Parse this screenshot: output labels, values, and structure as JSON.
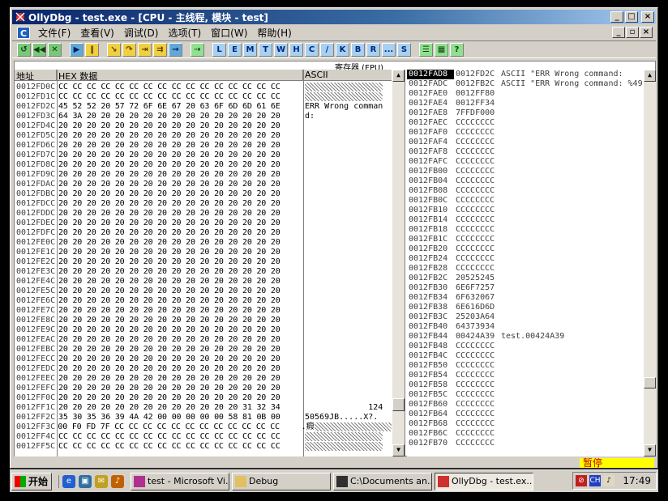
{
  "window": {
    "title": "OllyDbg - test.exe - [CPU - 主线程, 模块 - test]",
    "buttons": {
      "minimize": "_",
      "maximize": "□",
      "close": "×"
    }
  },
  "menu": {
    "items": [
      "文件(F)",
      "查看(V)",
      "调试(D)",
      "选项(T)",
      "窗口(W)",
      "帮助(H)"
    ],
    "mdi": {
      "minimize": "_",
      "restore": "▫",
      "close": "×"
    }
  },
  "toolbar": {
    "buttons": [
      {
        "label": "↺",
        "style": "green",
        "icon": "open-icon"
      },
      {
        "label": "◀◀",
        "style": "green",
        "icon": "restart-icon"
      },
      {
        "label": "✕",
        "style": "green",
        "icon": "close-program-icon"
      },
      {
        "label": "▶",
        "style": "blue",
        "icon": "run-icon"
      },
      {
        "label": "‖",
        "style": "yellow",
        "icon": "pause-icon"
      },
      {
        "label": "↘",
        "style": "yellow",
        "icon": "step-into-icon"
      },
      {
        "label": "↷",
        "style": "yellow",
        "icon": "step-over-icon"
      },
      {
        "label": "⇥",
        "style": "yellow",
        "icon": "trace-into-icon"
      },
      {
        "label": "⇉",
        "style": "yellow",
        "icon": "trace-over-icon"
      },
      {
        "label": "→",
        "style": "blue",
        "icon": "execute-till-return-icon"
      },
      {
        "label": "⇢",
        "style": "lgreen",
        "icon": "goto-icon"
      },
      {
        "label": "L",
        "style": "letter",
        "icon": "log-icon"
      },
      {
        "label": "E",
        "style": "letter",
        "icon": "modules-icon"
      },
      {
        "label": "M",
        "style": "letter",
        "icon": "memory-icon"
      },
      {
        "label": "T",
        "style": "letter",
        "icon": "threads-icon"
      },
      {
        "label": "W",
        "style": "letter",
        "icon": "windows-icon"
      },
      {
        "label": "H",
        "style": "letter",
        "icon": "handles-icon"
      },
      {
        "label": "C",
        "style": "letter",
        "icon": "cpu-icon"
      },
      {
        "label": "/",
        "style": "letter",
        "icon": "patches-icon"
      },
      {
        "label": "K",
        "style": "letter",
        "icon": "call-stack-icon"
      },
      {
        "label": "B",
        "style": "letter",
        "icon": "breakpoints-icon"
      },
      {
        "label": "R",
        "style": "letter",
        "icon": "references-icon"
      },
      {
        "label": "...",
        "style": "letter",
        "icon": "run-trace-icon"
      },
      {
        "label": "S",
        "style": "letter",
        "icon": "source-icon"
      },
      {
        "label": "☰",
        "style": "lgreen",
        "icon": "list-icon"
      },
      {
        "label": "▦",
        "style": "lgreen",
        "icon": "grid-icon"
      },
      {
        "label": "?",
        "style": "lgreen",
        "icon": "help-icon"
      }
    ]
  },
  "registers_tab": "寄存器 (FPU)",
  "dump": {
    "header": {
      "address": "地址",
      "hex": "HEX 数据",
      "ascii": "ASCII"
    },
    "rows": [
      {
        "addr": "0012FD0C",
        "hex": "CC CC CC CC CC CC CC CC CC CC CC CC CC CC CC CC",
        "ascii": "",
        "garbled": true
      },
      {
        "addr": "0012FD1C",
        "hex": "CC CC CC CC CC CC CC CC CC CC CC CC CC CC CC CC",
        "ascii": "",
        "garbled": true
      },
      {
        "addr": "0012FD2C",
        "hex": "45 52 52 20 57 72 6F 6E 67 20 63 6F 6D 6D 61 6E",
        "ascii": "ERR Wrong comman",
        "garbled": false
      },
      {
        "addr": "0012FD3C",
        "hex": "64 3A 20 20 20 20 20 20 20 20 20 20 20 20 20 20",
        "ascii": "d:",
        "garbled": false
      },
      {
        "addr": "0012FD4C",
        "hex": "20 20 20 20 20 20 20 20 20 20 20 20 20 20 20 20",
        "ascii": "",
        "garbled": false
      },
      {
        "addr": "0012FD5C",
        "hex": "20 20 20 20 20 20 20 20 20 20 20 20 20 20 20 20",
        "ascii": "",
        "garbled": false
      },
      {
        "addr": "0012FD6C",
        "hex": "20 20 20 20 20 20 20 20 20 20 20 20 20 20 20 20",
        "ascii": "",
        "garbled": false
      },
      {
        "addr": "0012FD7C",
        "hex": "20 20 20 20 20 20 20 20 20 20 20 20 20 20 20 20",
        "ascii": "",
        "garbled": false
      },
      {
        "addr": "0012FD8C",
        "hex": "20 20 20 20 20 20 20 20 20 20 20 20 20 20 20 20",
        "ascii": "",
        "garbled": false
      },
      {
        "addr": "0012FD9C",
        "hex": "20 20 20 20 20 20 20 20 20 20 20 20 20 20 20 20",
        "ascii": "",
        "garbled": false
      },
      {
        "addr": "0012FDAC",
        "hex": "20 20 20 20 20 20 20 20 20 20 20 20 20 20 20 20",
        "ascii": "",
        "garbled": false
      },
      {
        "addr": "0012FDBC",
        "hex": "20 20 20 20 20 20 20 20 20 20 20 20 20 20 20 20",
        "ascii": "",
        "garbled": false
      },
      {
        "addr": "0012FDCC",
        "hex": "20 20 20 20 20 20 20 20 20 20 20 20 20 20 20 20",
        "ascii": "",
        "garbled": false
      },
      {
        "addr": "0012FDDC",
        "hex": "20 20 20 20 20 20 20 20 20 20 20 20 20 20 20 20",
        "ascii": "",
        "garbled": false
      },
      {
        "addr": "0012FDEC",
        "hex": "20 20 20 20 20 20 20 20 20 20 20 20 20 20 20 20",
        "ascii": "",
        "garbled": false
      },
      {
        "addr": "0012FDFC",
        "hex": "20 20 20 20 20 20 20 20 20 20 20 20 20 20 20 20",
        "ascii": "",
        "garbled": false
      },
      {
        "addr": "0012FE0C",
        "hex": "20 20 20 20 20 20 20 20 20 20 20 20 20 20 20 20",
        "ascii": "",
        "garbled": false
      },
      {
        "addr": "0012FE1C",
        "hex": "20 20 20 20 20 20 20 20 20 20 20 20 20 20 20 20",
        "ascii": "",
        "garbled": false
      },
      {
        "addr": "0012FE2C",
        "hex": "20 20 20 20 20 20 20 20 20 20 20 20 20 20 20 20",
        "ascii": "",
        "garbled": false
      },
      {
        "addr": "0012FE3C",
        "hex": "20 20 20 20 20 20 20 20 20 20 20 20 20 20 20 20",
        "ascii": "",
        "garbled": false
      },
      {
        "addr": "0012FE4C",
        "hex": "20 20 20 20 20 20 20 20 20 20 20 20 20 20 20 20",
        "ascii": "",
        "garbled": false
      },
      {
        "addr": "0012FE5C",
        "hex": "20 20 20 20 20 20 20 20 20 20 20 20 20 20 20 20",
        "ascii": "",
        "garbled": false
      },
      {
        "addr": "0012FE6C",
        "hex": "20 20 20 20 20 20 20 20 20 20 20 20 20 20 20 20",
        "ascii": "",
        "garbled": false
      },
      {
        "addr": "0012FE7C",
        "hex": "20 20 20 20 20 20 20 20 20 20 20 20 20 20 20 20",
        "ascii": "",
        "garbled": false
      },
      {
        "addr": "0012FE8C",
        "hex": "20 20 20 20 20 20 20 20 20 20 20 20 20 20 20 20",
        "ascii": "",
        "garbled": false
      },
      {
        "addr": "0012FE9C",
        "hex": "20 20 20 20 20 20 20 20 20 20 20 20 20 20 20 20",
        "ascii": "",
        "garbled": false
      },
      {
        "addr": "0012FEAC",
        "hex": "20 20 20 20 20 20 20 20 20 20 20 20 20 20 20 20",
        "ascii": "",
        "garbled": false
      },
      {
        "addr": "0012FEBC",
        "hex": "20 20 20 20 20 20 20 20 20 20 20 20 20 20 20 20",
        "ascii": "",
        "garbled": false
      },
      {
        "addr": "0012FECC",
        "hex": "20 20 20 20 20 20 20 20 20 20 20 20 20 20 20 20",
        "ascii": "",
        "garbled": false
      },
      {
        "addr": "0012FEDC",
        "hex": "20 20 20 20 20 20 20 20 20 20 20 20 20 20 20 20",
        "ascii": "",
        "garbled": false
      },
      {
        "addr": "0012FEEC",
        "hex": "20 20 20 20 20 20 20 20 20 20 20 20 20 20 20 20",
        "ascii": "",
        "garbled": false
      },
      {
        "addr": "0012FEFC",
        "hex": "20 20 20 20 20 20 20 20 20 20 20 20 20 20 20 20",
        "ascii": "",
        "garbled": false
      },
      {
        "addr": "0012FF0C",
        "hex": "20 20 20 20 20 20 20 20 20 20 20 20 20 20 20 20",
        "ascii": "",
        "garbled": false
      },
      {
        "addr": "0012FF1C",
        "hex": "20 20 20 20 20 20 20 20 20 20 20 20 20 31 32 34",
        "ascii": "             124",
        "garbled": false
      },
      {
        "addr": "0012FF2C",
        "hex": "35 30 35 36 39 4A 42 00 00 00 00 00 58 81 0B 00",
        "ascii": "50569JB.....X?.",
        "garbled": false
      },
      {
        "addr": "0012FF3C",
        "hex": "00 F0 FD 7F CC CC CC CC CC CC CC CC CC CC CC CC",
        "ascii": ".瘕",
        "garbled": true
      },
      {
        "addr": "0012FF4C",
        "hex": "CC CC CC CC CC CC CC CC CC CC CC CC CC CC CC CC",
        "ascii": "",
        "garbled": true
      },
      {
        "addr": "0012FF5C",
        "hex": "CC CC CC CC CC CC CC CC CC CC CC CC CC CC CC CC",
        "ascii": "",
        "garbled": true
      }
    ]
  },
  "stack": {
    "rows": [
      {
        "addr": "0012FAD8",
        "val": "0012FD2C",
        "com": "ASCII \"ERR Wrong command:",
        "sel": true
      },
      {
        "addr": "0012FADC",
        "val": "0012FB2C",
        "com": "ASCII \"ERR Wrong command: %49",
        "sel": false
      },
      {
        "addr": "0012FAE0",
        "val": "0012FF80",
        "com": "",
        "sel": false
      },
      {
        "addr": "0012FAE4",
        "val": "0012FF34",
        "com": "",
        "sel": false
      },
      {
        "addr": "0012FAE8",
        "val": "7FFDF000",
        "com": "",
        "sel": false
      },
      {
        "addr": "0012FAEC",
        "val": "CCCCCCCC",
        "com": "",
        "sel": false
      },
      {
        "addr": "0012FAF0",
        "val": "CCCCCCCC",
        "com": "",
        "sel": false
      },
      {
        "addr": "0012FAF4",
        "val": "CCCCCCCC",
        "com": "",
        "sel": false
      },
      {
        "addr": "0012FAF8",
        "val": "CCCCCCCC",
        "com": "",
        "sel": false
      },
      {
        "addr": "0012FAFC",
        "val": "CCCCCCCC",
        "com": "",
        "sel": false
      },
      {
        "addr": "0012FB00",
        "val": "CCCCCCCC",
        "com": "",
        "sel": false
      },
      {
        "addr": "0012FB04",
        "val": "CCCCCCCC",
        "com": "",
        "sel": false
      },
      {
        "addr": "0012FB08",
        "val": "CCCCCCCC",
        "com": "",
        "sel": false
      },
      {
        "addr": "0012FB0C",
        "val": "CCCCCCCC",
        "com": "",
        "sel": false
      },
      {
        "addr": "0012FB10",
        "val": "CCCCCCCC",
        "com": "",
        "sel": false
      },
      {
        "addr": "0012FB14",
        "val": "CCCCCCCC",
        "com": "",
        "sel": false
      },
      {
        "addr": "0012FB18",
        "val": "CCCCCCCC",
        "com": "",
        "sel": false
      },
      {
        "addr": "0012FB1C",
        "val": "CCCCCCCC",
        "com": "",
        "sel": false
      },
      {
        "addr": "0012FB20",
        "val": "CCCCCCCC",
        "com": "",
        "sel": false
      },
      {
        "addr": "0012FB24",
        "val": "CCCCCCCC",
        "com": "",
        "sel": false
      },
      {
        "addr": "0012FB28",
        "val": "CCCCCCCC",
        "com": "",
        "sel": false
      },
      {
        "addr": "0012FB2C",
        "val": "20525245",
        "com": "",
        "sel": false
      },
      {
        "addr": "0012FB30",
        "val": "6E6F7257",
        "com": "",
        "sel": false
      },
      {
        "addr": "0012FB34",
        "val": "6F632067",
        "com": "",
        "sel": false
      },
      {
        "addr": "0012FB38",
        "val": "6E616D6D",
        "com": "",
        "sel": false
      },
      {
        "addr": "0012FB3C",
        "val": "25203A64",
        "com": "",
        "sel": false
      },
      {
        "addr": "0012FB40",
        "val": "64373934",
        "com": "",
        "sel": false
      },
      {
        "addr": "0012FB44",
        "val": "00424A39",
        "com": "test.00424A39",
        "sel": false
      },
      {
        "addr": "0012FB48",
        "val": "CCCCCCCC",
        "com": "",
        "sel": false
      },
      {
        "addr": "0012FB4C",
        "val": "CCCCCCCC",
        "com": "",
        "sel": false
      },
      {
        "addr": "0012FB50",
        "val": "CCCCCCCC",
        "com": "",
        "sel": false
      },
      {
        "addr": "0012FB54",
        "val": "CCCCCCCC",
        "com": "",
        "sel": false
      },
      {
        "addr": "0012FB58",
        "val": "CCCCCCCC",
        "com": "",
        "sel": false
      },
      {
        "addr": "0012FB5C",
        "val": "CCCCCCCC",
        "com": "",
        "sel": false
      },
      {
        "addr": "0012FB60",
        "val": "CCCCCCCC",
        "com": "",
        "sel": false
      },
      {
        "addr": "0012FB64",
        "val": "CCCCCCCC",
        "com": "",
        "sel": false
      },
      {
        "addr": "0012FB68",
        "val": "CCCCCCCC",
        "com": "",
        "sel": false
      },
      {
        "addr": "0012FB6C",
        "val": "CCCCCCCC",
        "com": "",
        "sel": false
      },
      {
        "addr": "0012FB70",
        "val": "CCCCCCCC",
        "com": "",
        "sel": false
      }
    ]
  },
  "status": {
    "paused": "暂停"
  },
  "taskbar": {
    "start": "开始",
    "quicklaunch": [
      {
        "icon": "ie-icon",
        "label": "e",
        "color": "#2060d0"
      },
      {
        "icon": "desktop-icon",
        "label": "▣",
        "color": "#3070a0"
      },
      {
        "icon": "outlook-icon",
        "label": "✉",
        "color": "#c0a020"
      },
      {
        "icon": "media-icon",
        "label": "♪",
        "color": "#c06000"
      }
    ],
    "tasks": [
      {
        "label": "test - Microsoft Vi...",
        "icon": "visual-studio-icon",
        "active": false
      },
      {
        "label": "Debug",
        "icon": "folder-icon",
        "active": false
      },
      {
        "label": "C:\\Documents an...",
        "icon": "console-icon",
        "active": false
      },
      {
        "label": "OllyDbg - test.ex...",
        "icon": "ollydbg-icon",
        "active": true
      }
    ],
    "tray": {
      "lang": "CH",
      "time": "17:49"
    }
  }
}
